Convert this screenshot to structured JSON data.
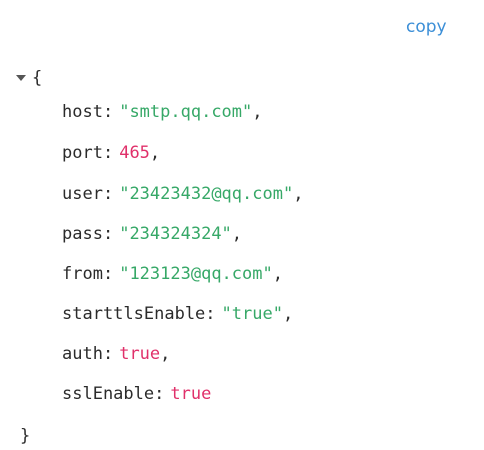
{
  "toolbar": {
    "copy_label": "copy"
  },
  "json": {
    "open_brace": "{",
    "close_brace": "}",
    "fields": [
      {
        "key": "host",
        "value": "\"smtp.qq.com\"",
        "type": "string",
        "comma": ","
      },
      {
        "key": "port",
        "value": "465",
        "type": "number",
        "comma": ","
      },
      {
        "key": "user",
        "value": "\"23423432@qq.com\"",
        "type": "string",
        "comma": ","
      },
      {
        "key": "pass",
        "value": "\"234324324\"",
        "type": "string",
        "comma": ","
      },
      {
        "key": "from",
        "value": "\"123123@qq.com\"",
        "type": "string",
        "comma": ","
      },
      {
        "key": "starttlsEnable",
        "value": "\"true\"",
        "type": "string",
        "comma": ","
      },
      {
        "key": "auth",
        "value": "true",
        "type": "boolean",
        "comma": ","
      },
      {
        "key": "sslEnable",
        "value": "true",
        "type": "boolean",
        "comma": ""
      }
    ]
  },
  "colors": {
    "copy": "#3c8fd7",
    "string": "#36a867",
    "number": "#e0306a",
    "boolean": "#e0306a",
    "text": "#2b2b2b"
  }
}
